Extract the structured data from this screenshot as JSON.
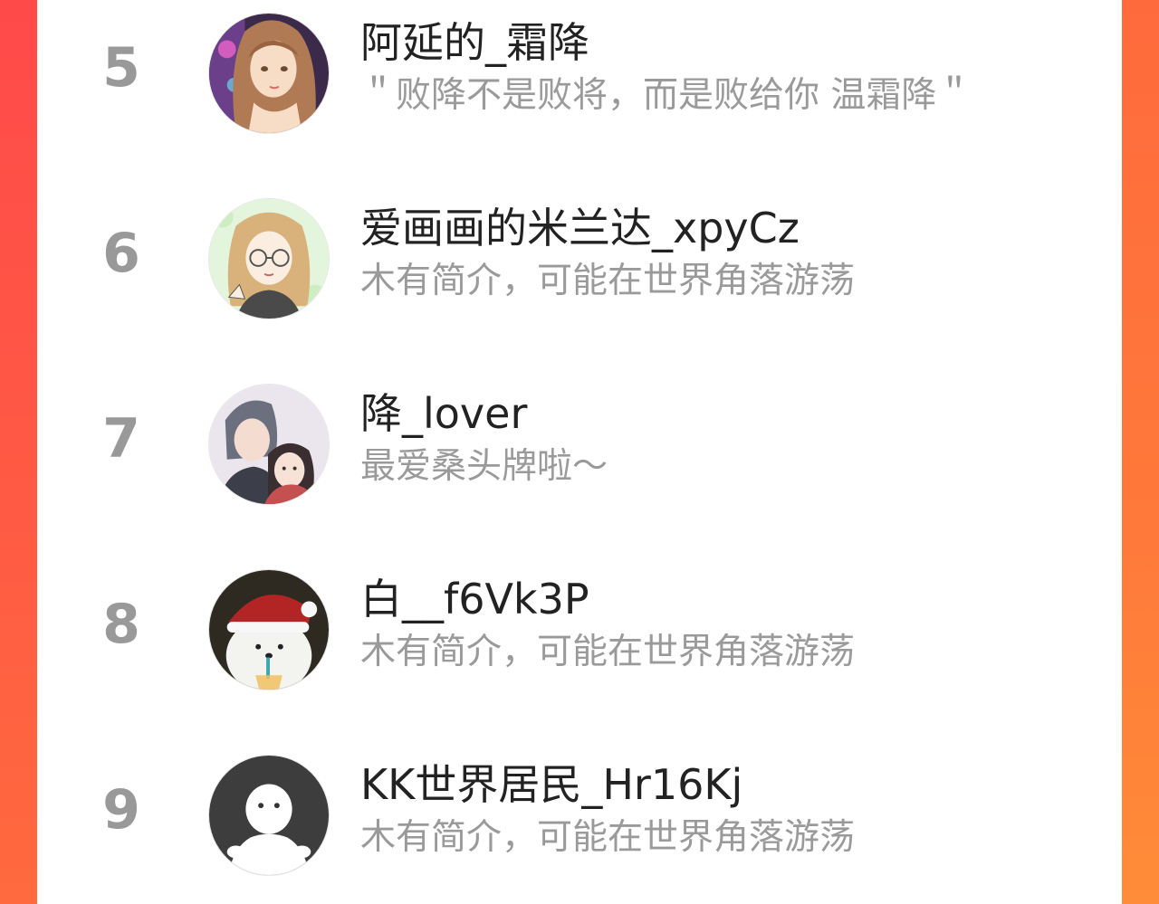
{
  "colors": {
    "accent_left": "#ff4a4a",
    "accent_right": "#ff7a3a",
    "rank_text": "#999999",
    "name_text": "#222222",
    "bio_text": "#9a9a9a"
  },
  "ranking": {
    "items": [
      {
        "rank": "5",
        "name": "阿延的_霜降",
        "bio": "＂败降不是败将，而是败给你 温霜降＂",
        "avatar_icon": "anime-girl-avatar"
      },
      {
        "rank": "6",
        "name": "爱画画的米兰达_xpyCz",
        "bio": "木有简介，可能在世界角落游荡",
        "avatar_icon": "drawn-girl-glasses-avatar"
      },
      {
        "rank": "7",
        "name": "降_lover",
        "bio": "最爱桑头牌啦～",
        "avatar_icon": "anime-couple-avatar"
      },
      {
        "rank": "8",
        "name": "白__f6Vk3P",
        "bio": "木有简介，可能在世界角落游荡",
        "avatar_icon": "polar-bear-santa-hat-avatar"
      },
      {
        "rank": "9",
        "name": "KK世界居民_Hr16Kj",
        "bio": "木有简介，可能在世界角落游荡",
        "avatar_icon": "default-user-avatar"
      }
    ]
  }
}
